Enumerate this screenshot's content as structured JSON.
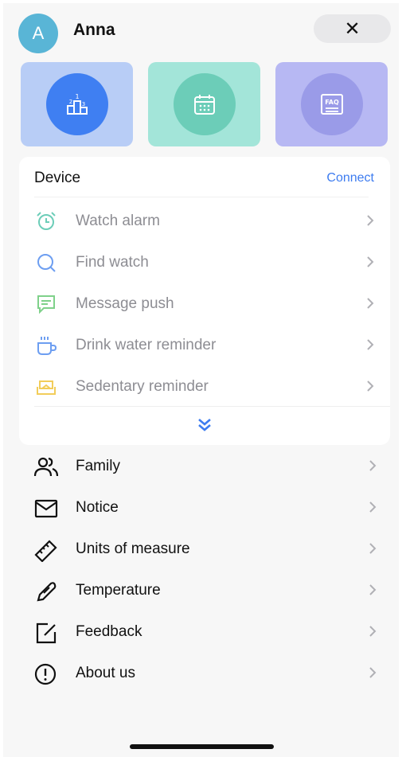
{
  "header": {
    "avatar_letter": "A",
    "username": "Anna",
    "close_symbol": "✕"
  },
  "tiles": [
    {
      "icon": "podium-ranking-icon",
      "color": "#3f7ff2"
    },
    {
      "icon": "calendar-icon",
      "color": "#6ccdb8"
    },
    {
      "icon": "faq-icon",
      "color": "#9a9be8"
    }
  ],
  "device": {
    "title": "Device",
    "action": "Connect",
    "items": [
      {
        "label": "Watch alarm",
        "icon": "alarm-clock-icon"
      },
      {
        "label": "Find watch",
        "icon": "search-icon"
      },
      {
        "label": "Message push",
        "icon": "message-icon"
      },
      {
        "label": "Drink water reminder",
        "icon": "cup-icon"
      },
      {
        "label": "Sedentary reminder",
        "icon": "seat-icon"
      }
    ],
    "expand_icon": "double-chevron-down-icon"
  },
  "settings": [
    {
      "label": "Family",
      "icon": "family-icon"
    },
    {
      "label": "Notice",
      "icon": "envelope-icon"
    },
    {
      "label": "Units of measure",
      "icon": "ruler-icon"
    },
    {
      "label": "Temperature",
      "icon": "feather-pen-icon"
    },
    {
      "label": "Feedback",
      "icon": "edit-icon"
    },
    {
      "label": "About us",
      "icon": "info-exclamation-icon"
    }
  ]
}
